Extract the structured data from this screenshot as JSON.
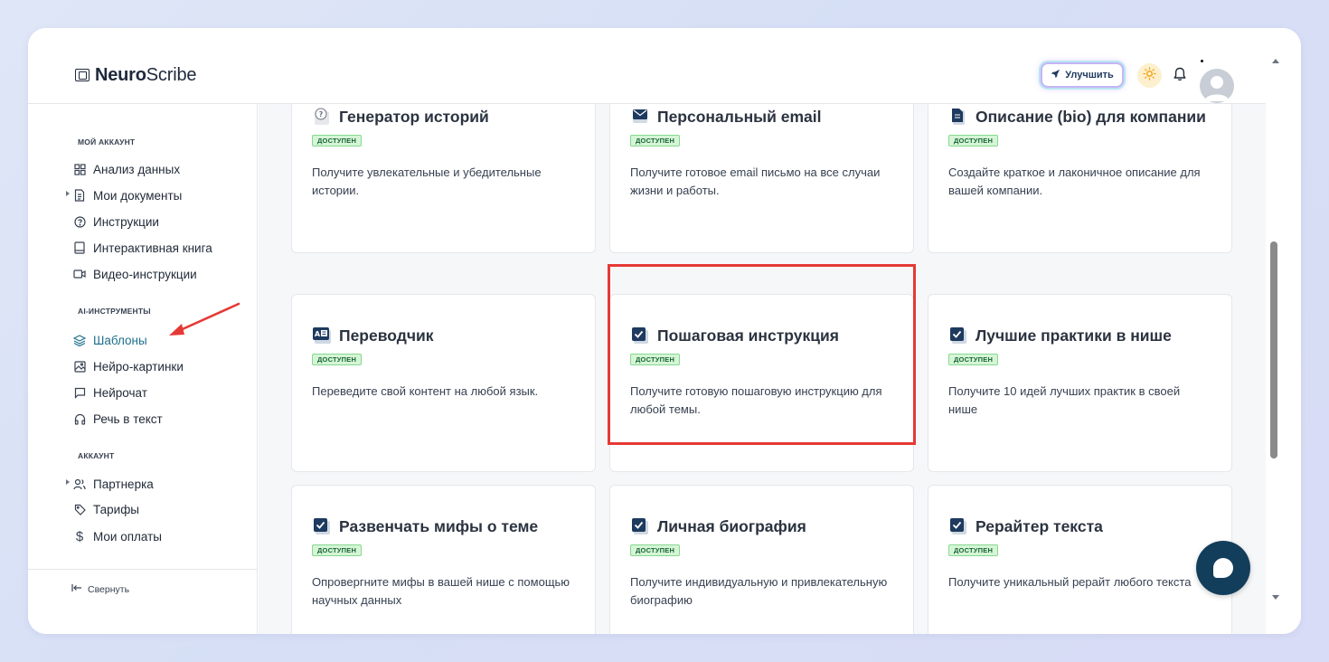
{
  "app": {
    "logo_bold": "Neuro",
    "logo_rest": "Scribe"
  },
  "header": {
    "upgrade_label": "Улучшить"
  },
  "sidebar": {
    "sections": [
      {
        "title": "МОЙ АККАУНТ"
      },
      {
        "title": "AI-ИНСТРУМЕНТЫ"
      },
      {
        "title": "АККАУНТ"
      }
    ],
    "items": [
      {
        "label": "Анализ данных",
        "icon": "grid-icon"
      },
      {
        "label": "Мои документы",
        "icon": "document-icon"
      },
      {
        "label": "Инструкции",
        "icon": "question-circle-icon"
      },
      {
        "label": "Интерактивная книга",
        "icon": "book-icon"
      },
      {
        "label": "Видео-инструкции",
        "icon": "video-icon"
      },
      {
        "label": "Шаблоны",
        "icon": "layers-icon",
        "active": true
      },
      {
        "label": "Нейро-картинки",
        "icon": "image-icon"
      },
      {
        "label": "Нейрочат",
        "icon": "chat-icon"
      },
      {
        "label": "Речь в текст",
        "icon": "headphones-icon"
      },
      {
        "label": "Партнерка",
        "icon": "users-icon"
      },
      {
        "label": "Тарифы",
        "icon": "tag-icon"
      },
      {
        "label": "Мои оплаты",
        "icon": "dollar-icon"
      }
    ],
    "collapse_label": "Свернуть"
  },
  "cards": [
    {
      "title": "Генератор историй",
      "badge": "ДОСТУПЕН",
      "desc": "Получите увлекательные и убедительные истории.",
      "icon": "question-emoji-icon"
    },
    {
      "title": "Персональный email",
      "badge": "ДОСТУПЕН",
      "desc": "Получите готовое email письмо на все случаи жизни и работы.",
      "icon": "envelope-icon"
    },
    {
      "title": "Описание (bio) для компании",
      "badge": "ДОСТУПЕН",
      "desc": "Создайте краткое и лаконичное описание для вашей компании.",
      "icon": "page-icon"
    },
    {
      "title": "Переводчик",
      "badge": "ДОСТУПЕН",
      "desc": "Переведите свой контент на любой язык.",
      "icon": "translate-icon"
    },
    {
      "title": "Пошаговая инструкция",
      "badge": "ДОСТУПЕН",
      "desc": "Получите готовую пошаговую инструкцию для любой темы.",
      "icon": "checkbox-icon"
    },
    {
      "title": "Лучшие практики в нише",
      "badge": "ДОСТУПЕН",
      "desc": "Получите 10 идей лучших практик в своей нише",
      "icon": "checkbox-icon"
    },
    {
      "title": "Развенчать мифы о теме",
      "badge": "ДОСТУПЕН",
      "desc": "Опровергните мифы в вашей нише с помощью научных данных",
      "icon": "checkbox-icon"
    },
    {
      "title": "Личная биография",
      "badge": "ДОСТУПЕН",
      "desc": "Получите индивидуальную и привлекательную биографию",
      "icon": "checkbox-icon"
    },
    {
      "title": "Рерайтер текста",
      "badge": "ДОСТУПЕН",
      "desc": "Получите уникальный рерайт любого текста",
      "icon": "checkbox-icon"
    }
  ],
  "colors": {
    "accent": "#1f6f8b",
    "highlight": "#e53935",
    "badge_bg": "#d6f5d6",
    "badge_text": "#166534",
    "chat_button": "#123e5b"
  }
}
